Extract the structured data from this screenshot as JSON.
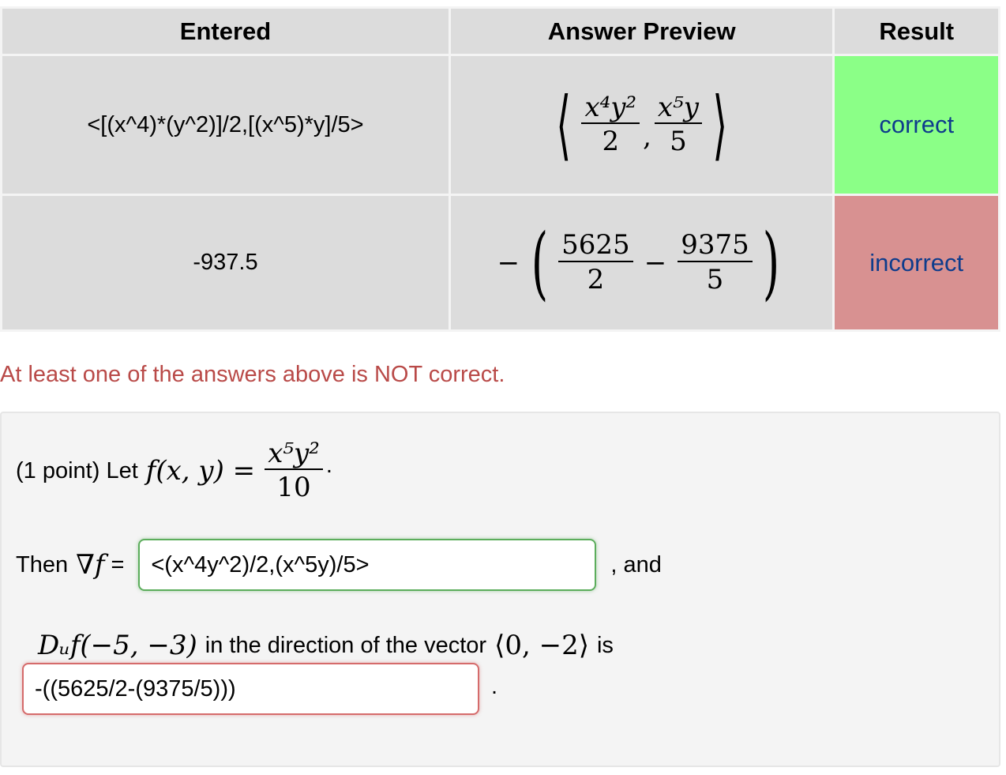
{
  "results_table": {
    "headers": [
      "Entered",
      "Answer Preview",
      "Result"
    ],
    "rows": [
      {
        "entered": "<[(x^4)*(y^2)]/2,[(x^5)*y]/5>",
        "preview": {
          "num1": "x⁴y²",
          "den1": "2",
          "sep": ",",
          "num2": "x⁵y",
          "den2": "5"
        },
        "result": "correct"
      },
      {
        "entered": "-937.5",
        "preview": {
          "lead": "−",
          "num1": "5625",
          "den1": "2",
          "minus": "−",
          "num2": "9375",
          "den2": "5"
        },
        "result": "incorrect"
      }
    ]
  },
  "feedback_message": "At least one of the answers above is NOT correct.",
  "problem": {
    "points": "(1 point) Let",
    "function_lhs": "f(x, y) =",
    "function_num": "x⁵y²",
    "function_den": "10",
    "then_label": "Then",
    "grad_symbol": "∇f",
    "equals": "=",
    "gradient_answer": "<(x^4y^2)/2,(x^5y)/5>",
    "and_text": ", and",
    "directional_expr": "Dᵤf(−5, −3)",
    "direction_text": "in the direction of the vector",
    "vector": "⟨0, −2⟩",
    "is_text": "is",
    "directional_answer": "-((5625/2-(9375/5)))",
    "period": "."
  },
  "colors": {
    "correct_bg": "#8bff87",
    "incorrect_bg": "#d89191",
    "result_text": "#0e3c8c",
    "message_text": "#b94a48"
  }
}
